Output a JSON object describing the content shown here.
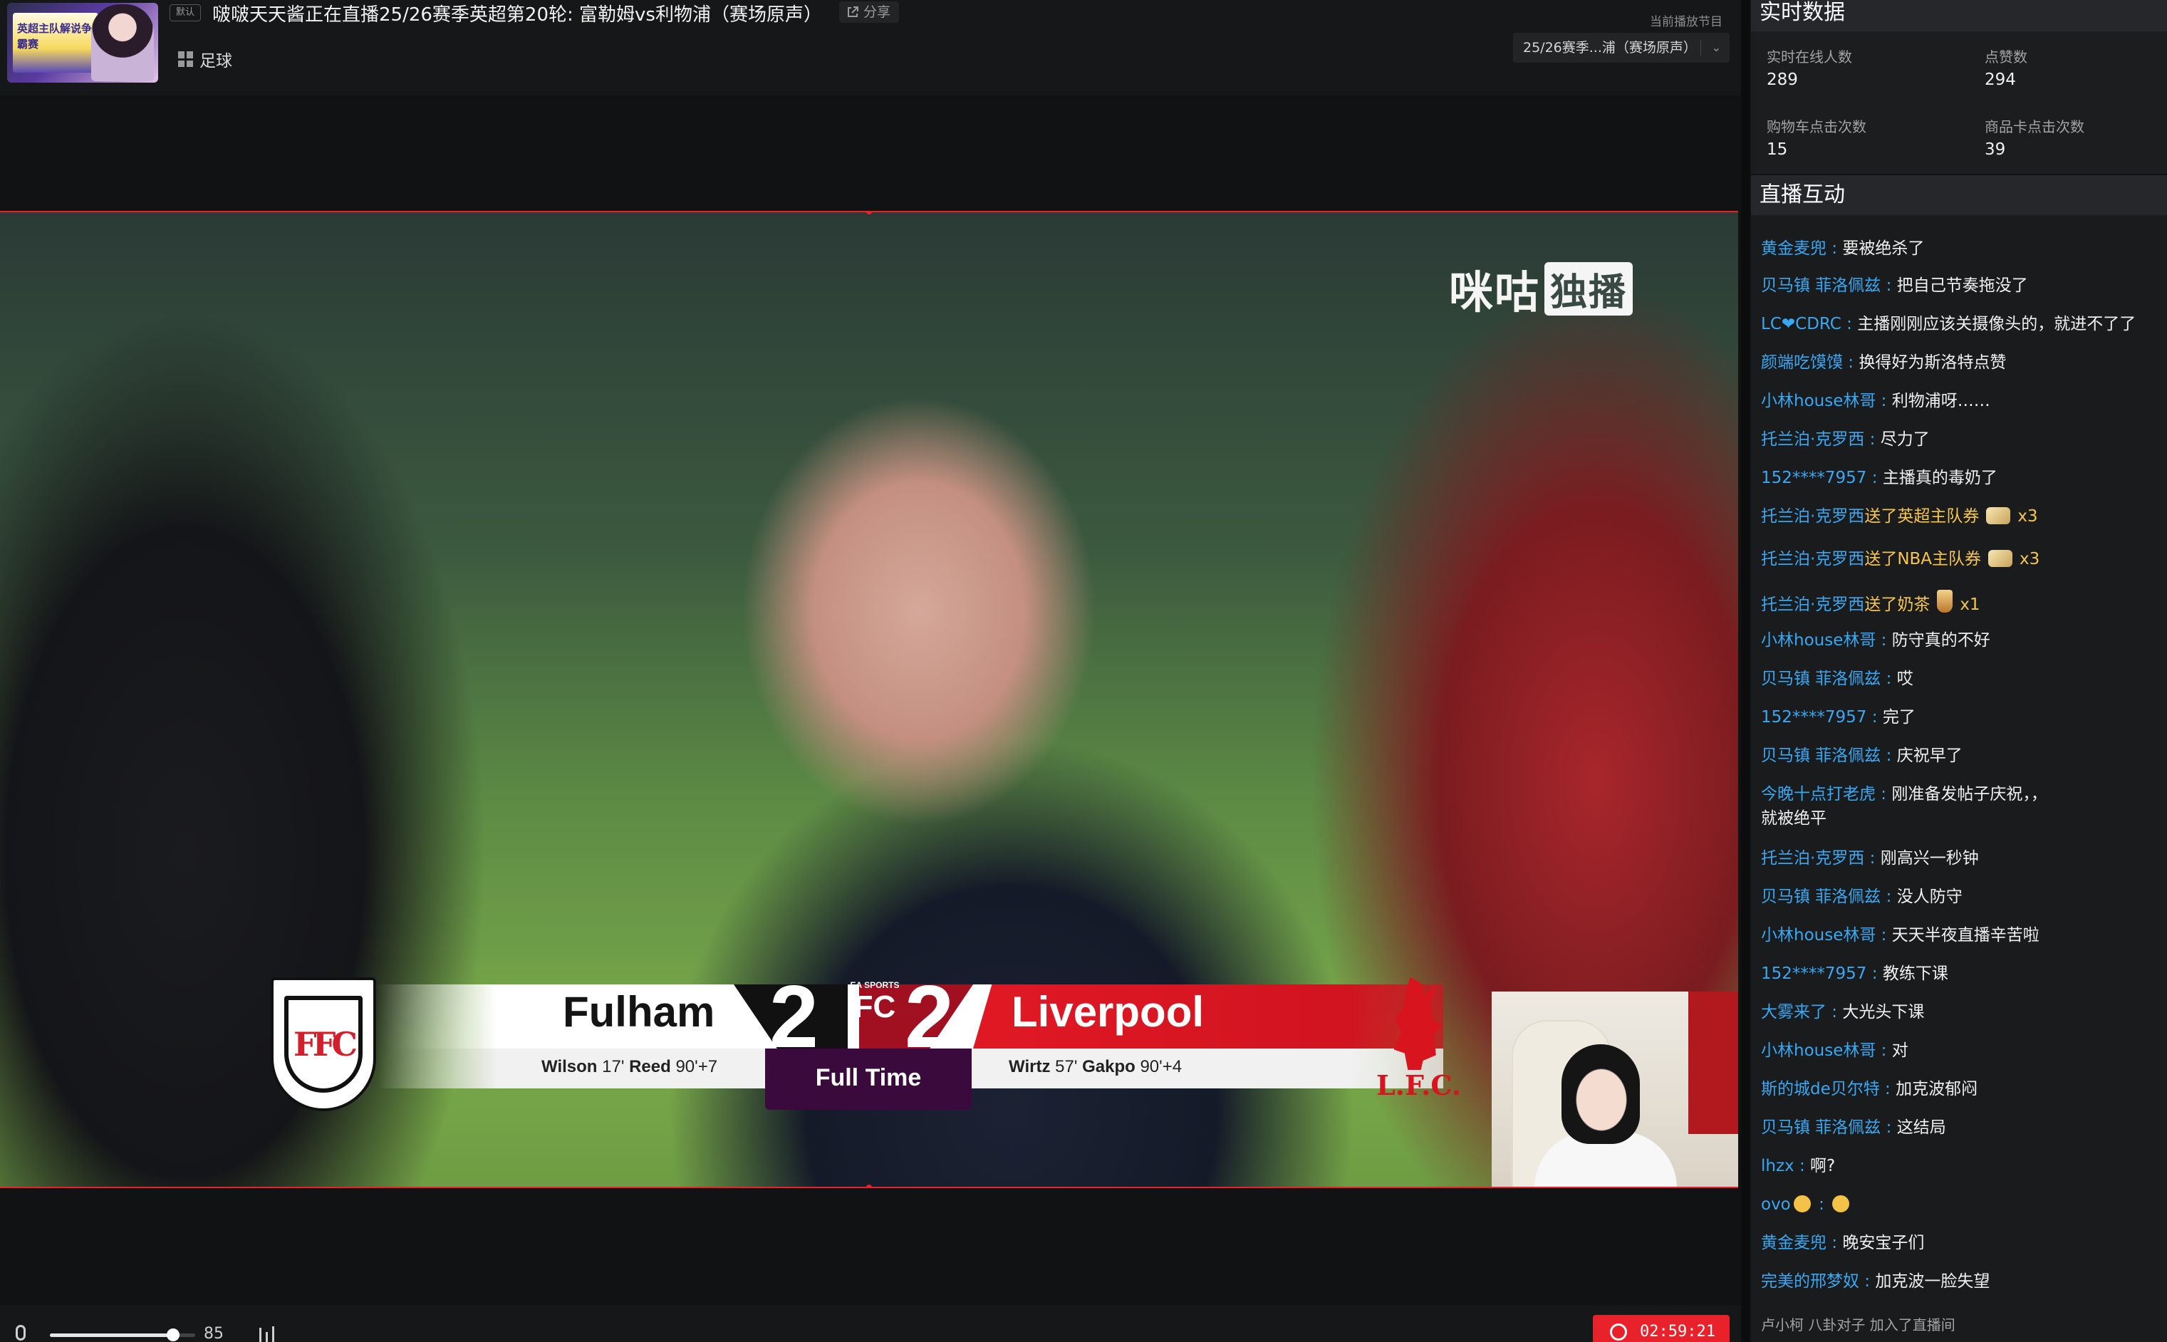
{
  "header": {
    "thumbnail_text": "英超主队解说争霸赛",
    "badge": "默认",
    "title": "啵啵天天酱正在直播25/26赛季英超第20轮: 富勒姆vs利物浦（赛场原声）",
    "share_label": "分享",
    "category": "足球",
    "current_program_label": "当前播放节目",
    "current_program_value": "25/26赛季...浦（赛场原声）"
  },
  "video": {
    "watermark_text": "咪咕",
    "watermark_badge": "独播",
    "scoreboard": {
      "home_team": "Fulham",
      "home_score": "2",
      "home_scorers": [
        {
          "name": "Wilson",
          "minute": "17'"
        },
        {
          "name": "Reed",
          "minute": "90'+7"
        }
      ],
      "away_team": "Liverpool",
      "away_score": "2",
      "away_scorers": [
        {
          "name": "Wirtz",
          "minute": "57'"
        },
        {
          "name": "Gakpo",
          "minute": "90'+4"
        }
      ],
      "status": "Full Time",
      "center_logo_top": "EA SPORTS",
      "center_logo_main": "FC",
      "away_crest_text": "L.F.C."
    }
  },
  "controls": {
    "volume": 85,
    "volume_label": "85",
    "timer": "02:59:21"
  },
  "realtime": {
    "title": "实时数据",
    "stats": [
      {
        "label": "实时在线人数",
        "value": "289"
      },
      {
        "label": "点赞数",
        "value": "294"
      },
      {
        "label": "购物车点击次数",
        "value": "15"
      },
      {
        "label": "商品卡点击次数",
        "value": "39"
      }
    ]
  },
  "interaction": {
    "title": "直播互动",
    "messages": [
      {
        "user": "黄金麦兜",
        "sep": " : ",
        "text": "要被绝杀了"
      },
      {
        "user": "贝马镇 菲洛佩兹",
        "sep": " : ",
        "text": "把自己节奏拖没了"
      },
      {
        "user": "LC❤CDRC",
        "sep": " : ",
        "text": "主播刚刚应该关摄像头的，就进不了了"
      },
      {
        "user": "颜端吃馍馍",
        "sep": " : ",
        "text": "换得好为斯洛特点赞"
      },
      {
        "user": "小林house林哥",
        "sep": " : ",
        "text": "利物浦呀……"
      },
      {
        "user": "托兰泊·克罗西",
        "sep": " : ",
        "text": "尽力了"
      },
      {
        "user": "152****7957",
        "sep": " : ",
        "text": "主播真的毒奶了"
      },
      {
        "user": "托兰泊·克罗西",
        "gift": "送了英超主队券",
        "count": "x3",
        "icon": "ticket"
      },
      {
        "user": "托兰泊·克罗西",
        "gift": "送了NBA主队券",
        "count": "x3",
        "icon": "ticket"
      },
      {
        "user": "托兰泊·克罗西",
        "gift": "送了奶茶",
        "count": "x1",
        "icon": "milk-tea"
      },
      {
        "user": "小林house林哥",
        "sep": " : ",
        "text": "防守真的不好"
      },
      {
        "user": "贝马镇 菲洛佩兹",
        "sep": " : ",
        "text": "哎"
      },
      {
        "user": "152****7957",
        "sep": " : ",
        "text": "完了"
      },
      {
        "user": "贝马镇 菲洛佩兹",
        "sep": " : ",
        "text": "庆祝早了"
      },
      {
        "user": "今晚十点打老虎",
        "sep": " : ",
        "text": "刚准备发帖子庆祝，，",
        "text_line2": "就被绝平"
      },
      {
        "user": "托兰泊·克罗西",
        "sep": " : ",
        "text": "刚高兴一秒钟"
      },
      {
        "user": "贝马镇 菲洛佩兹",
        "sep": " : ",
        "text": "没人防守"
      },
      {
        "user": "小林house林哥",
        "sep": " : ",
        "text": "天天半夜直播辛苦啦"
      },
      {
        "user": "152****7957",
        "sep": " : ",
        "text": "教练下课"
      },
      {
        "user": "大雾来了",
        "sep": " : ",
        "text": "大光头下课"
      },
      {
        "user": "小林house林哥",
        "sep": " : ",
        "text": "对"
      },
      {
        "user": "斯的城de贝尔特",
        "sep": " : ",
        "text": "加克波郁闷"
      },
      {
        "user": "贝马镇 菲洛佩兹",
        "sep": " : ",
        "text": "这结局"
      },
      {
        "user": "lhzx",
        "sep": " : ",
        "text": "啊?"
      },
      {
        "user": "ovo",
        "sep": " : ",
        "text": "",
        "emoji": true
      },
      {
        "user": "黄金麦兜",
        "sep": " : ",
        "text": "晚安宝子们"
      },
      {
        "user": "完美的邢梦奴",
        "sep": " : ",
        "text": "加克波一脸失望"
      }
    ],
    "system_message": "卢小柯 八卦对子 加入了直播间"
  },
  "colors": {
    "accent": "#e8212a",
    "username": "#3aa7f2",
    "gift": "#f6c64c",
    "fulltime_bg": "#3a0a3c"
  }
}
